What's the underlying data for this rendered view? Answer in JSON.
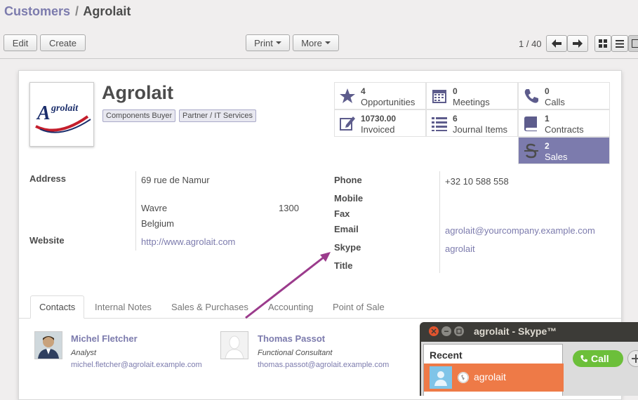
{
  "breadcrumb": {
    "parent": "Customers",
    "sep": "/",
    "current": "Agrolait"
  },
  "toolbar": {
    "edit": "Edit",
    "create": "Create",
    "print": "Print",
    "more": "More"
  },
  "pager": {
    "text": "1 / 40"
  },
  "partner": {
    "name": "Agrolait",
    "logo_text": "Agrolait",
    "tags": [
      "Components Buyer",
      "Partner / IT Services"
    ]
  },
  "stats": [
    {
      "num": "4",
      "label": "Opportunities",
      "icon": "star-icon"
    },
    {
      "num": "0",
      "label": "Meetings",
      "icon": "calendar-icon"
    },
    {
      "num": "0",
      "label": "Calls",
      "icon": "phone-icon"
    },
    {
      "num": "10730.00",
      "label": "Invoiced",
      "icon": "edit-icon"
    },
    {
      "num": "6",
      "label": "Journal Items",
      "icon": "list-icon"
    },
    {
      "num": "1",
      "label": "Contracts",
      "icon": "book-icon"
    },
    {
      "num": "2",
      "label": "Sales",
      "icon": "strikethrough-icon"
    }
  ],
  "fields": {
    "address_label": "Address",
    "street": "69 rue de Namur",
    "city": "Wavre",
    "zip": "1300",
    "country": "Belgium",
    "website_label": "Website",
    "website": "http://www.agrolait.com",
    "phone_label": "Phone",
    "phone": "+32 10 588 558",
    "mobile_label": "Mobile",
    "fax_label": "Fax",
    "email_label": "Email",
    "email": "agrolait@yourcompany.example.com",
    "skype_label": "Skype",
    "skype": "agrolait",
    "title_label": "Title"
  },
  "tabs": [
    "Contacts",
    "Internal Notes",
    "Sales & Purchases",
    "Accounting",
    "Point of Sale"
  ],
  "contacts": [
    {
      "name": "Michel Fletcher",
      "role": "Analyst",
      "email": "michel.fletcher@agrolait.example.com"
    },
    {
      "name": "Thomas Passot",
      "role": "Functional Consultant",
      "email": "thomas.passot@agrolait.example.com"
    }
  ],
  "skype_window": {
    "title": "agrolait - Skype™",
    "recent_header": "Recent",
    "recent_item": "agrolait",
    "call_label": "Call"
  },
  "colors": {
    "accent": "#7c7bad",
    "skype_orange": "#ee7a47",
    "call_green": "#6cbf3a",
    "arrow": "#9b3b8c"
  }
}
